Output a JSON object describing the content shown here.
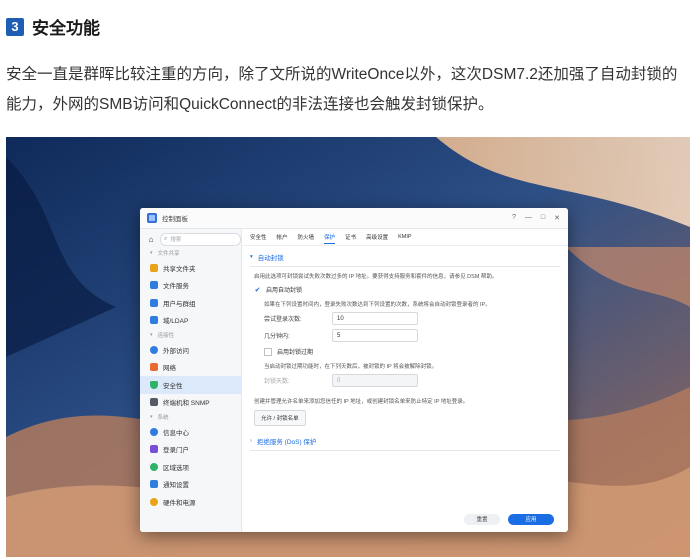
{
  "article": {
    "section_number": "3",
    "heading": "安全功能",
    "paragraph": "安全一直是群晖比较注重的方向，除了文所说的WriteOnce以外，这次DSM7.2还加强了自动封锁的能力，外网的SMB访问和QuickConnect的非法连接也会触发封锁保护。"
  },
  "window": {
    "title": "控制面板",
    "controls": {
      "help": "?",
      "minimize": "—",
      "maximize": "□",
      "close": "✕"
    }
  },
  "sidebar": {
    "search_placeholder": "搜索",
    "groups": [
      {
        "label": "文件共享",
        "items": [
          {
            "label": "共享文件夹",
            "icon": "folder-share-icon",
            "color": "#e8a318"
          },
          {
            "label": "文件服务",
            "icon": "file-services-icon",
            "color": "#2f7de1"
          },
          {
            "label": "用户与群组",
            "icon": "user-group-icon",
            "color": "#2f7de1"
          },
          {
            "label": "域/LDAP",
            "icon": "domain-ldap-icon",
            "color": "#2f7de1"
          }
        ]
      },
      {
        "label": "连接性",
        "items": [
          {
            "label": "外部访问",
            "icon": "external-access-icon",
            "color": "#2f7de1"
          },
          {
            "label": "网络",
            "icon": "network-icon",
            "color": "#e86a2f"
          },
          {
            "label": "安全性",
            "icon": "security-shield-icon",
            "color": "#2fb26a",
            "active": true
          },
          {
            "label": "终端机和 SNMP",
            "icon": "terminal-icon",
            "color": "#555b66"
          }
        ]
      },
      {
        "label": "系统",
        "items": [
          {
            "label": "信息中心",
            "icon": "info-center-icon",
            "color": "#2f7de1"
          },
          {
            "label": "登录门户",
            "icon": "login-portal-icon",
            "color": "#7a4fd8"
          },
          {
            "label": "区域选项",
            "icon": "regional-options-icon",
            "color": "#2fb26a"
          },
          {
            "label": "通知设置",
            "icon": "notification-icon",
            "color": "#2f7de1"
          },
          {
            "label": "硬件和电源",
            "icon": "hardware-power-icon",
            "color": "#e8a318"
          }
        ]
      }
    ]
  },
  "tabs": [
    "安全性",
    "帐户",
    "防火墙",
    "保护",
    "证书",
    "高级设置",
    "KMIP"
  ],
  "active_tab_index": 3,
  "auto_block": {
    "section_title": "自动封锁",
    "description": "启用此选项可封锁尝试失败次数过多的 IP 地址。要获得支持服务和套件的信息，请参见 DSM 帮助。",
    "enable_label": "启用自动封锁",
    "enabled": true,
    "rule_desc": "如果在下列设置时间内，登录失败次数达到下列设置的次数，系统将会自动封锁登录者的 IP。",
    "attempts_label": "尝试登录次数:",
    "attempts_value": "10",
    "within_label": "几分钟内:",
    "within_value": "5",
    "expire_label": "启用封锁过期",
    "expire_enabled": false,
    "expire_desc": "当启动封锁过期功能时，在下列天数后，被封锁的 IP 将会被解除封锁。",
    "days_label": "封锁天数:",
    "days_value": "0",
    "allow_desc": "创建并管理允许名单来添加您信任的 IP 地址，或创建封锁名单来防止特定 IP 地址登录。",
    "allow_button": "允许 / 封锁名单"
  },
  "dos": {
    "section_title": "拒绝服务 (DoS) 保护"
  },
  "footer": {
    "reset": "重置",
    "apply": "应用"
  },
  "colors": {
    "accent": "#1a6de3",
    "badge": "#1e5fb4"
  }
}
